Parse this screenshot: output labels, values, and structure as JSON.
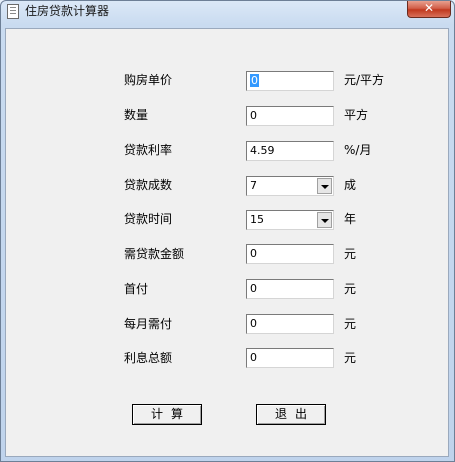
{
  "window": {
    "title": "住房贷款计算器",
    "close_glyph": "✕"
  },
  "form": {
    "unit_price_label": "购房单价",
    "unit_price_value": "0",
    "unit_price_unit": "元/平方",
    "quantity_label": "数量",
    "quantity_value": "0",
    "quantity_unit": "平方",
    "rate_label": "贷款利率",
    "rate_value": "4.59",
    "rate_unit": "%/月",
    "ratio_label": "贷款成数",
    "ratio_value": "7",
    "ratio_unit": "成",
    "term_label": "贷款时间",
    "term_value": "15",
    "term_unit": "年",
    "loan_amount_label": "需贷款金额",
    "loan_amount_value": "0",
    "loan_amount_unit": "元",
    "down_payment_label": "首付",
    "down_payment_value": "0",
    "down_payment_unit": "元",
    "monthly_label": "每月需付",
    "monthly_value": "0",
    "monthly_unit": "元",
    "interest_label": "利息总额",
    "interest_value": "0",
    "interest_unit": "元"
  },
  "buttons": {
    "calculate": "计算",
    "exit": "退出"
  }
}
